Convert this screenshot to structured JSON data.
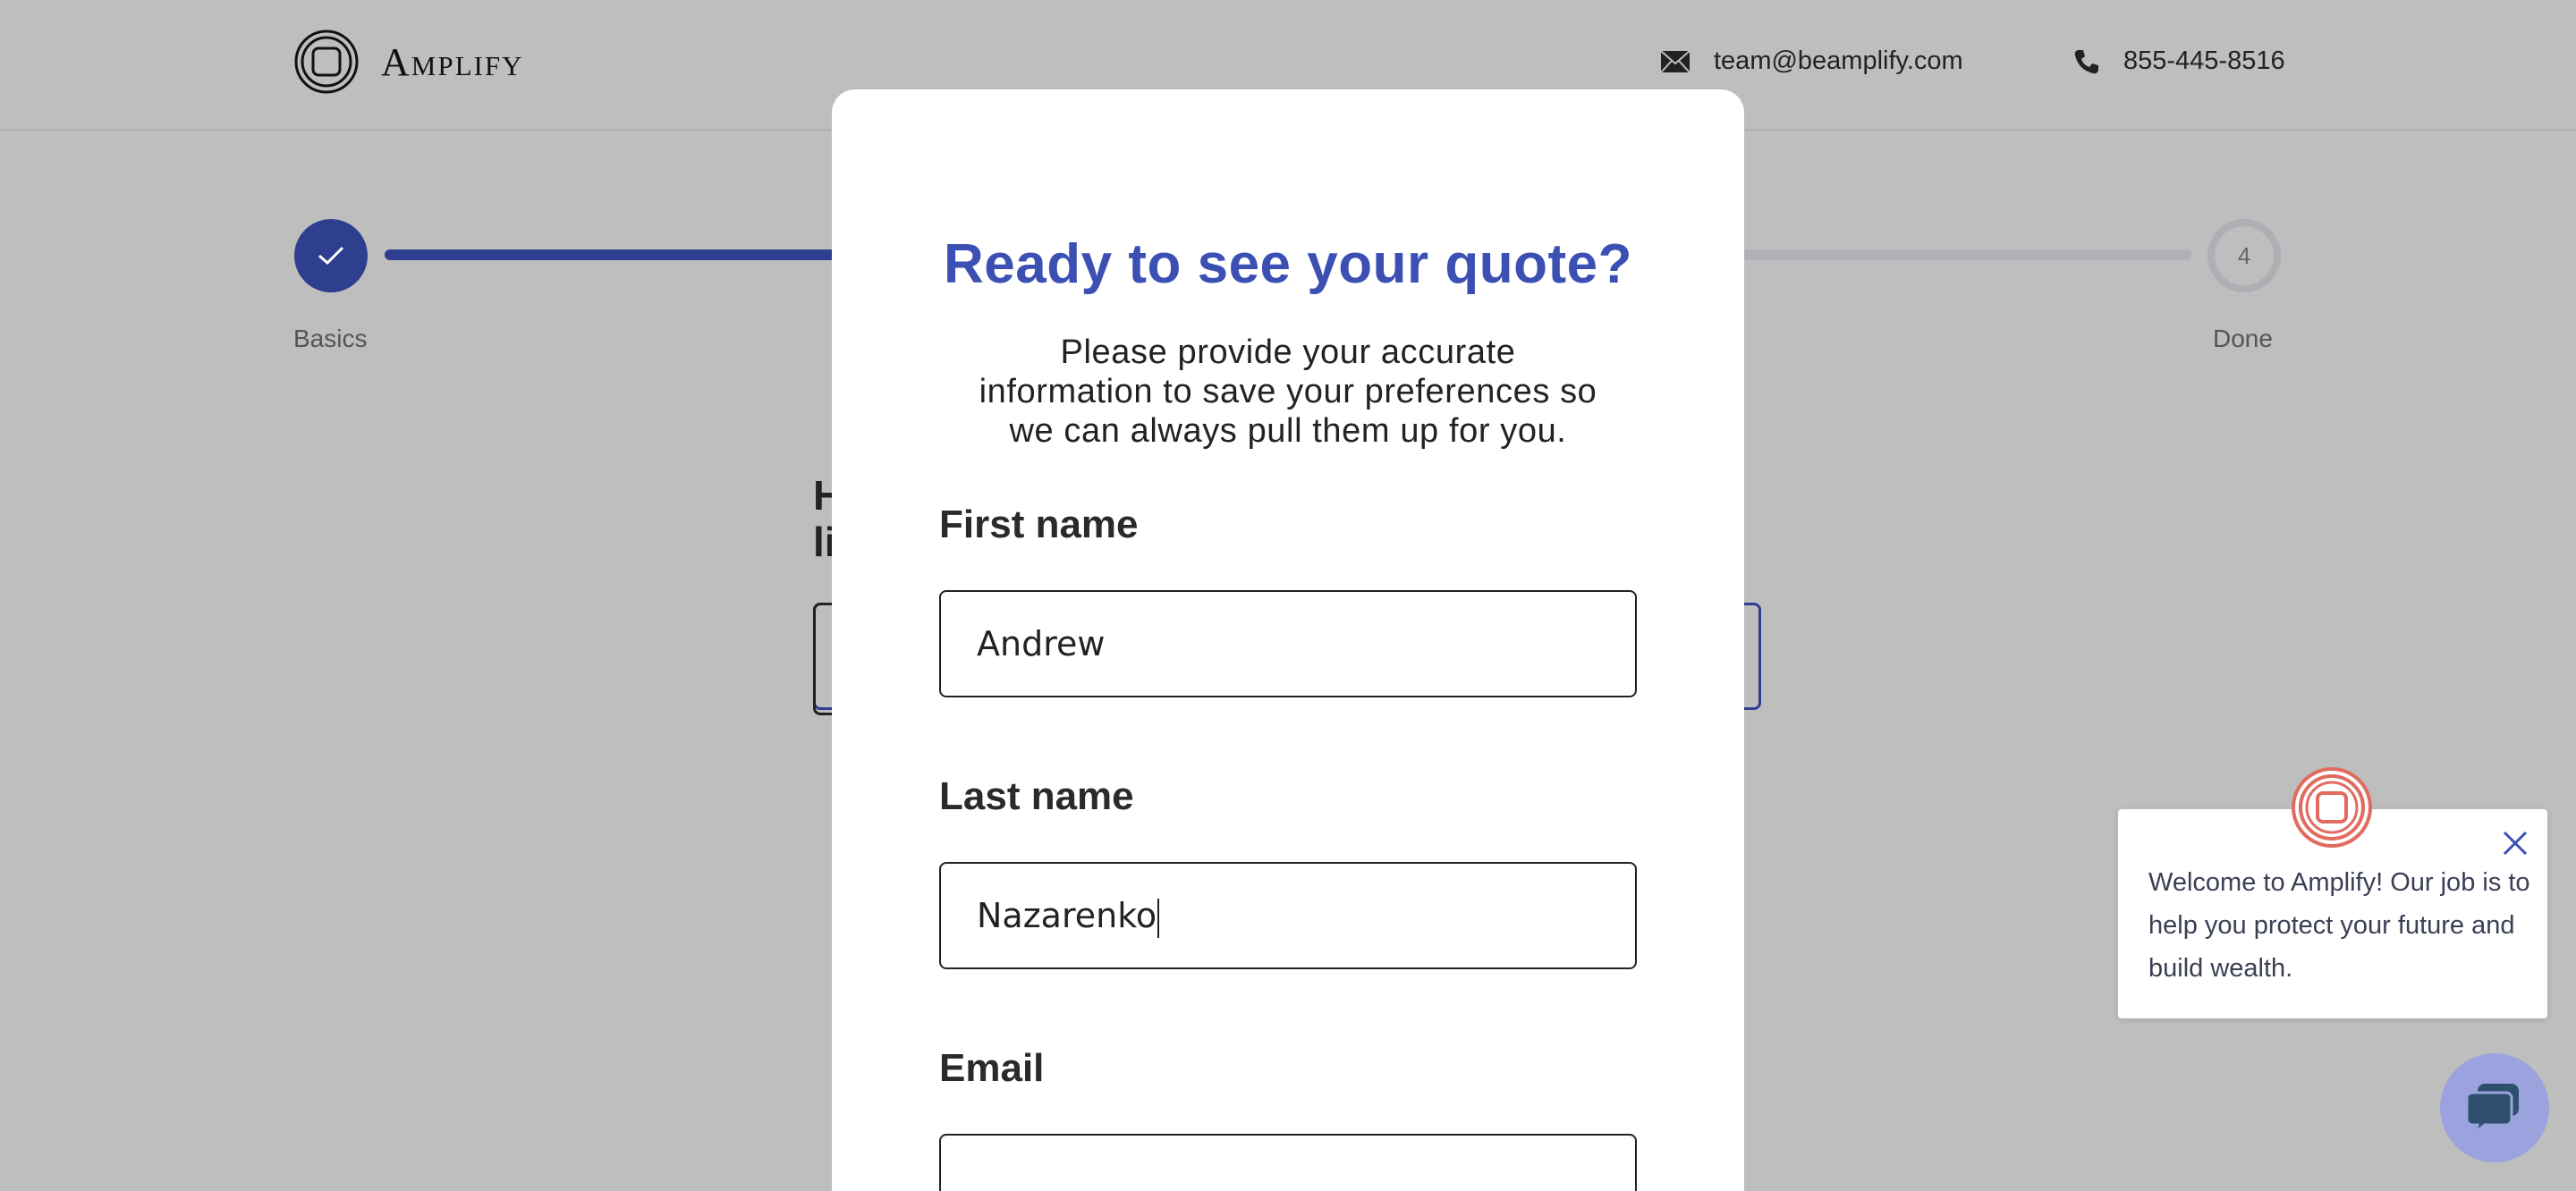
{
  "header": {
    "brand": "Amplify",
    "email": "team@beamplify.com",
    "phone": "855-445-8516"
  },
  "steps": {
    "first_label": "Basics",
    "last_number": "4",
    "last_label": "Done"
  },
  "background": {
    "question_line1": "H",
    "question_line2": "li"
  },
  "modal": {
    "title": "Ready to see your quote?",
    "description": "Please provide your accurate information to save your preferences so we can always pull them up for you.",
    "first_name_label": "First name",
    "first_name_value": "Andrew",
    "last_name_label": "Last name",
    "last_name_value": "Nazarenko",
    "email_label": "Email",
    "email_value": ""
  },
  "chat": {
    "message": "Welcome to Amplify! Our job is to help you protect your future and build wealth."
  },
  "colors": {
    "accent": "#3c4fb3",
    "progress": "#2f3f8f",
    "overlay": "#bebebe",
    "chat_launcher": "#9aa3dd",
    "chat_logo": "#e06b5f"
  }
}
